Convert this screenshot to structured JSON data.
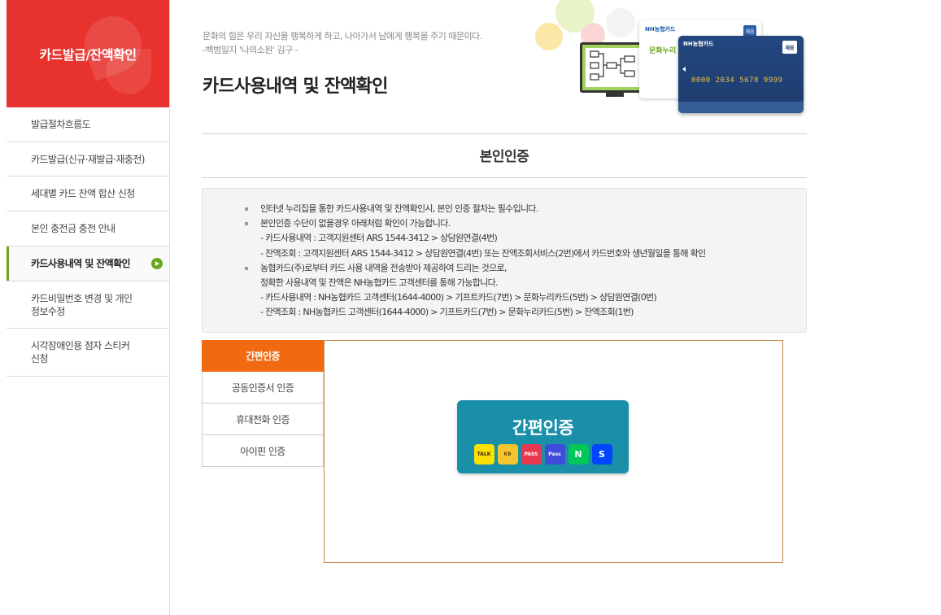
{
  "sidebar": {
    "title": "카드발급/잔액확인",
    "items": [
      {
        "label": "발급절차흐름도"
      },
      {
        "label": "카드발급(신규·재발급·재충전)"
      },
      {
        "label": "세대별 카드 잔액 합산 신청"
      },
      {
        "label": "본인 충전금 충전 안내"
      },
      {
        "label": "카드사용내역 및 잔액확인",
        "active": true
      },
      {
        "label": "카드비밀번호 변경 및 개인\n정보수정"
      },
      {
        "label": "시각장애인용 점자 스티커\n신청"
      }
    ]
  },
  "header": {
    "quote_line1": "문화의 힘은 우리 자신을 행복하게 하고, 나아가서 남에게 행복을 주기 때문이다.",
    "quote_line2": "-백범일지 '나의소원' 김구 -",
    "title": "카드사용내역 및 잔액확인"
  },
  "cards": {
    "white_brand": "NH농협카드",
    "white_text": "문화누리",
    "white_tag": "체음",
    "blue_brand": "NH농협카드",
    "blue_tag": "체음",
    "blue_number": "0000 2034 5678 9999"
  },
  "section": {
    "title": "본인인증"
  },
  "notice": {
    "lines": [
      "인터넷 누리집을 통한 카드사용내역 및 잔액확인시, 본인 인증 절차는 필수입니다.",
      "본인인증 수단이 없을경우 아래처럼 확인이 가능합니다.",
      "- 카드사용내역 : 고객지원센터 ARS 1544-3412 > 상담원연결(4번)",
      "- 잔액조회 : 고객지원센터 ARS 1544-3412 > 상담원연결(4번) 또는 잔액조회서비스(2번)에서 카드번호와 생년월일을 통해 확인",
      "농협카드(주)로부터 카드 사용 내역을 전송받아 제공하여 드리는 것으로,",
      "정확한 사용내역 및 잔액은 NH농협카드 고객센터를 통해 가능합니다.",
      "- 카드사용내역 : NH농협카드 고객센터(1644-4000) > 기프트카드(7번) > 문화누리카드(5번) > 상담원연결(0번)",
      "- 잔액조회 : NH농협카드 고객센터(1644-4000) > 기프트카드(7번) > 문화누리카드(5번) > 잔액조회(1번)"
    ]
  },
  "tabs": [
    {
      "label": "간편인증",
      "active": true
    },
    {
      "label": "공동인증서 인증"
    },
    {
      "label": "휴대전화 인증"
    },
    {
      "label": "아이핀 인증"
    }
  ],
  "auth": {
    "button_label": "간편인증",
    "providers": [
      {
        "name": "kakao-icon",
        "text": "TALK",
        "bg": "#fae100",
        "fg": "#3b1e1e"
      },
      {
        "name": "kb-icon",
        "text": "KB",
        "bg": "#f6c42d",
        "fg": "#6b4a00"
      },
      {
        "name": "pass-icon",
        "text": "PASS",
        "bg": "#e8384f",
        "fg": "#ffffff"
      },
      {
        "name": "payco-icon",
        "text": "Pass",
        "bg": "#3e4bdb",
        "fg": "#ffffff"
      },
      {
        "name": "naver-icon",
        "text": "N",
        "bg": "#03c75a",
        "fg": "#ffffff"
      },
      {
        "name": "shinhan-icon",
        "text": "S",
        "bg": "#0046ff",
        "fg": "#ffffff"
      }
    ]
  }
}
